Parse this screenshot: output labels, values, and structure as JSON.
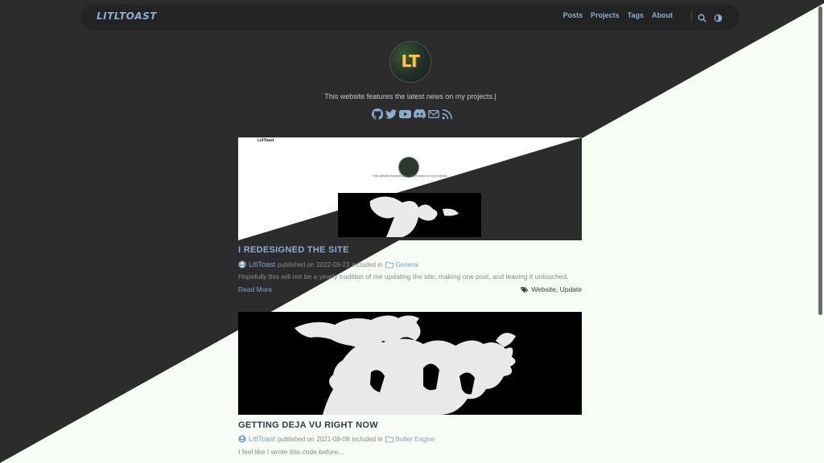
{
  "nav": {
    "brand": "LITLTOAST",
    "links": [
      "Posts",
      "Projects",
      "Tags",
      "About"
    ],
    "icons": [
      "search-icon",
      "theme-toggle-icon"
    ]
  },
  "header": {
    "avatar_text": "LT",
    "tagline": "This website features the latest news on my projects.|",
    "socials": [
      "github-icon",
      "twitter-icon",
      "youtube-icon",
      "discord-icon",
      "email-icon",
      "rss-icon"
    ]
  },
  "posts": [
    {
      "title": "I REDESIGNED THE SITE",
      "author": "LitlToast",
      "published_prefix": "published on",
      "date": "2022-09-23",
      "included_prefix": "included in",
      "category": "General",
      "summary": "Hopefully this will not be a yearly tradition of me updating the site, making one post, and leaving it untouched.",
      "read_more": "Read More",
      "tags_text": "Website, Update",
      "thumb_brand": "LitlToast",
      "thumb_tagline": "This website features the latest news on my projects."
    },
    {
      "title": "GETTING DEJA VU RIGHT NOW",
      "author": "LitlToast",
      "published_prefix": "published on",
      "date": "2021-08-08",
      "included_prefix": "included in",
      "category": "Butter Engine",
      "summary": "I feel like I wrote this code before..."
    }
  ],
  "colors": {
    "dark_bg": "#2c2c2c",
    "light_bg": "#f7fcf4",
    "accent": "#7aa4cc",
    "nav_bg": "#232323"
  }
}
